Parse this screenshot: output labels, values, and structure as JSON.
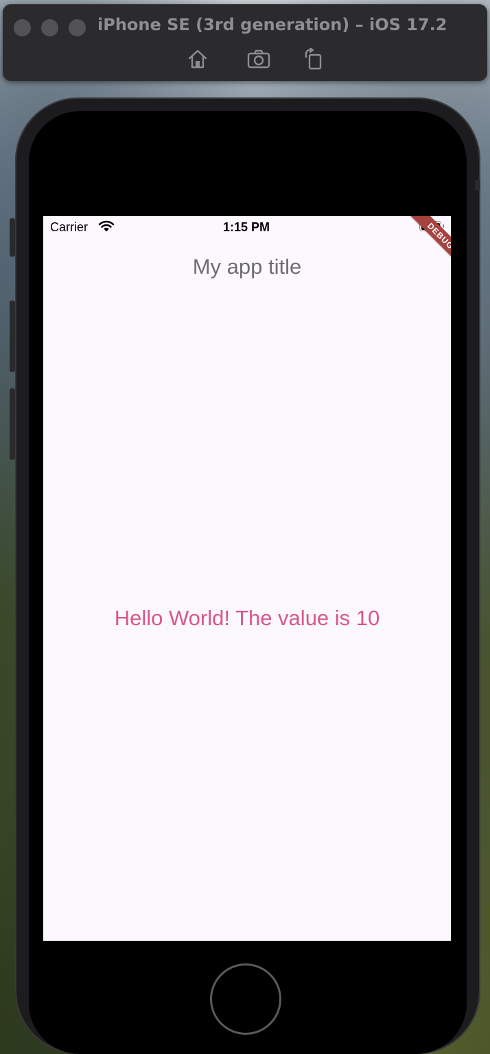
{
  "simulator": {
    "window_title": "iPhone SE (3rd generation) – iOS 17.2",
    "toolbar_icons": [
      "home-icon",
      "screenshot-icon",
      "rotate-icon"
    ]
  },
  "status_bar": {
    "carrier": "Carrier",
    "time": "1:15 PM"
  },
  "debug_banner": {
    "label": "DEBUG",
    "color": "#a8423f"
  },
  "app": {
    "title": "My app title",
    "body_text": "Hello World! The value is 10",
    "colors": {
      "background": "#fdf8fd",
      "title": "#6e6e72",
      "body_text": "#d9568b"
    }
  }
}
